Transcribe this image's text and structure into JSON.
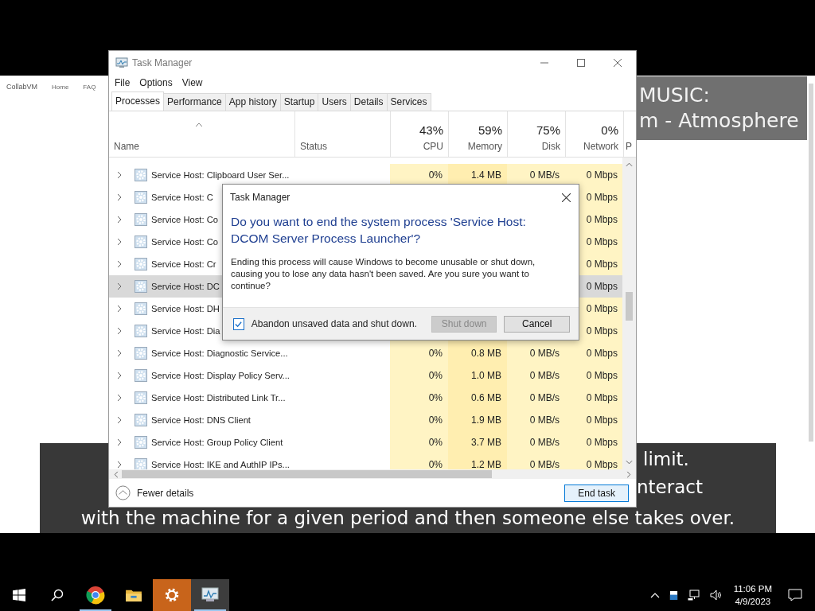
{
  "background_page": {
    "nav_items": [
      "CollabVM",
      "Home",
      "FAQ"
    ]
  },
  "banner": {
    "lines": [
      "MUSIC:",
      "m - Atmosphere"
    ]
  },
  "subtitle": {
    "lines": [
      "limit.",
      "nteract",
      "with the machine for a given period and then someone else takes over."
    ]
  },
  "window": {
    "title": "Task Manager",
    "menu": [
      "File",
      "Options",
      "View"
    ],
    "tabs": [
      {
        "label": "Processes",
        "selected": true
      },
      {
        "label": "Performance",
        "selected": false
      },
      {
        "label": "App history",
        "selected": false
      },
      {
        "label": "Startup",
        "selected": false
      },
      {
        "label": "Users",
        "selected": false
      },
      {
        "label": "Details",
        "selected": false
      },
      {
        "label": "Services",
        "selected": false
      }
    ],
    "columns": [
      {
        "label": "Name"
      },
      {
        "label": "Status"
      },
      {
        "label": "CPU",
        "percent": "43%"
      },
      {
        "label": "Memory",
        "percent": "59%"
      },
      {
        "label": "Disk",
        "percent": "75%"
      },
      {
        "label": "Network",
        "percent": "0%"
      },
      {
        "label": "P"
      }
    ],
    "rows": [
      {
        "name": "Service Host: Clipboard User Ser...",
        "selected": false,
        "cpu": "0%",
        "memory": "1.4 MB",
        "disk": "0 MB/s",
        "network": "0 Mbps"
      },
      {
        "name": "Service Host: C",
        "selected": false,
        "network": "0 Mbps"
      },
      {
        "name": "Service Host: Co",
        "selected": false,
        "network": "0 Mbps"
      },
      {
        "name": "Service Host: Co",
        "selected": false,
        "network": "0 Mbps"
      },
      {
        "name": "Service Host: Cr",
        "selected": false,
        "network": "0 Mbps"
      },
      {
        "name": "Service Host: DC",
        "selected": true,
        "network": "0 Mbps"
      },
      {
        "name": "Service Host: DH",
        "selected": false,
        "network": "0 Mbps"
      },
      {
        "name": "Service Host: Dia",
        "selected": false,
        "network": "0 Mbps"
      },
      {
        "name": "Service Host: Diagnostic Service...",
        "selected": false,
        "cpu": "0%",
        "memory": "0.8 MB",
        "disk": "0 MB/s",
        "network": "0 Mbps"
      },
      {
        "name": "Service Host: Display Policy Serv...",
        "selected": false,
        "cpu": "0%",
        "memory": "1.0 MB",
        "disk": "0 MB/s",
        "network": "0 Mbps"
      },
      {
        "name": "Service Host: Distributed Link Tr...",
        "selected": false,
        "cpu": "0%",
        "memory": "0.6 MB",
        "disk": "0 MB/s",
        "network": "0 Mbps"
      },
      {
        "name": "Service Host: DNS Client",
        "selected": false,
        "cpu": "0%",
        "memory": "1.9 MB",
        "disk": "0 MB/s",
        "network": "0 Mbps"
      },
      {
        "name": "Service Host: Group Policy Client",
        "selected": false,
        "cpu": "0%",
        "memory": "3.7 MB",
        "disk": "0 MB/s",
        "network": "0 Mbps"
      },
      {
        "name": "Service Host: IKE and AuthIP IPs...",
        "selected": false,
        "cpu": "0%",
        "memory": "1.2 MB",
        "disk": "0 MB/s",
        "network": "0 Mbps"
      }
    ],
    "footer": {
      "toggle": "Fewer details",
      "button": "End task"
    }
  },
  "dialog": {
    "title": "Task Manager",
    "heading": "Do you want to end the system process 'Service Host: DCOM Server Process Launcher'?",
    "message": "Ending this process will cause Windows to become unusable or shut down, causing you to lose any data hasn't been saved. Are you sure you want to continue?",
    "checkbox": {
      "label": "Abandon unsaved data and shut down.",
      "checked": true
    },
    "buttons": [
      {
        "label": "Shut down",
        "disabled": true
      },
      {
        "label": "Cancel",
        "disabled": false
      }
    ]
  },
  "taskbar": {
    "apps": [
      {
        "kind": "browser",
        "running": true,
        "selected": false,
        "flashing": false
      },
      {
        "kind": "folder",
        "running": false,
        "selected": false,
        "flashing": false
      },
      {
        "kind": "settings",
        "running": false,
        "selected": false,
        "flashing": true
      },
      {
        "kind": "taskmgr",
        "running": true,
        "selected": true,
        "flashing": false
      }
    ],
    "time": "11:06 PM",
    "date": "4/9/2023"
  }
}
